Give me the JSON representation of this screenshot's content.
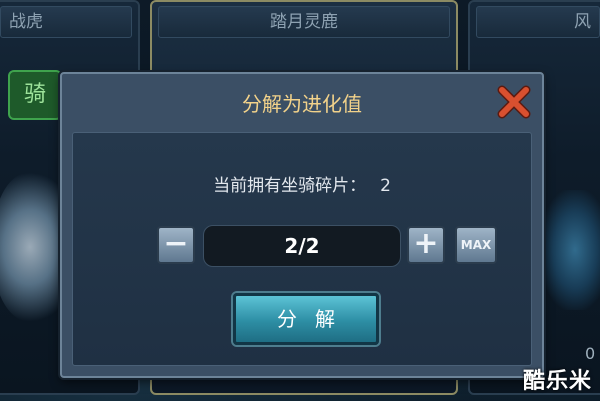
{
  "background": {
    "cards": [
      {
        "title": "战虎"
      },
      {
        "title": "踏月灵鹿"
      },
      {
        "title": "风"
      }
    ],
    "side_number": "0"
  },
  "dialog": {
    "title": "分解为进化值",
    "close_icon": "close-x-icon",
    "info_label": "当前拥有坐骑碎片：",
    "fragment_count": "2",
    "quantity": "2/2",
    "minus_label": "−",
    "plus_label": "+",
    "max_label": "MAX",
    "decompose_label": "分解"
  },
  "watermark": "酷乐米",
  "colors": {
    "title_gold": "#f2d28a",
    "close_red": "#d9502f",
    "button_teal": "#2d8ea4"
  }
}
